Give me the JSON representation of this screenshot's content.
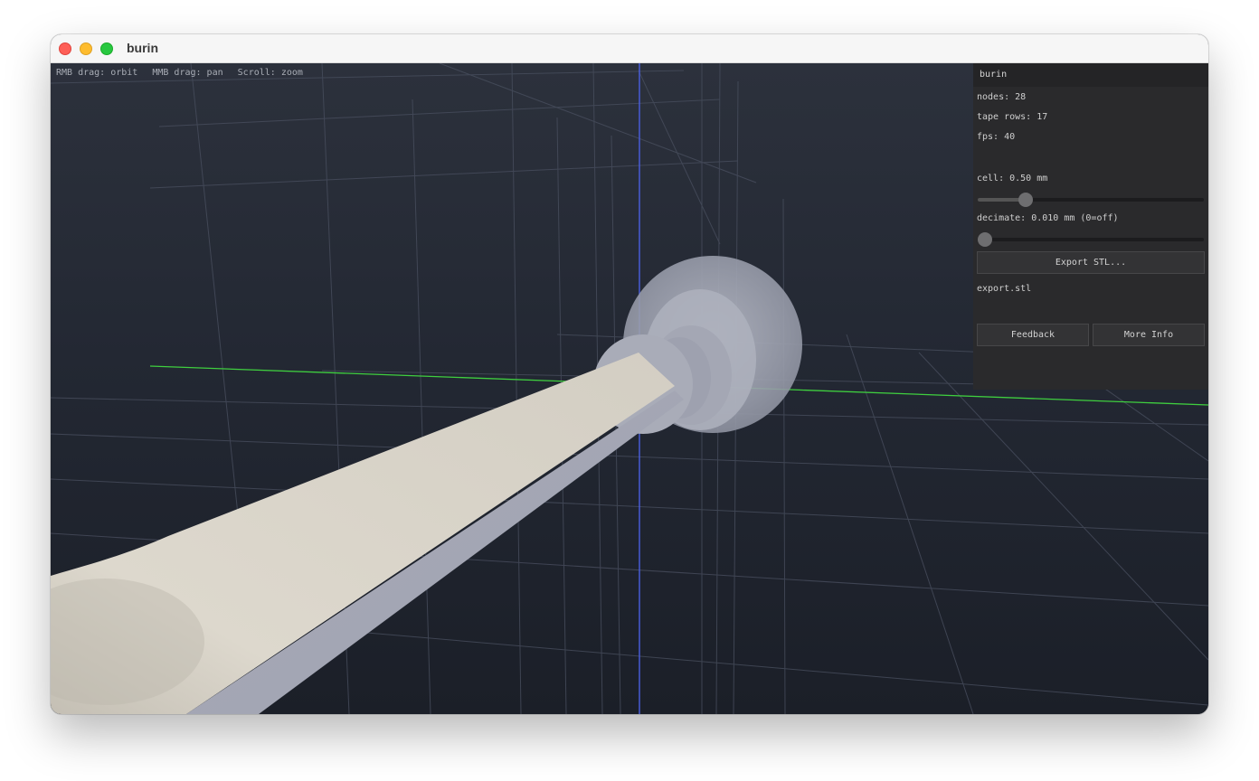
{
  "window": {
    "title": "burin"
  },
  "viewport": {
    "hints": [
      "RMB drag: orbit",
      "MMB drag: pan",
      "Scroll: zoom"
    ]
  },
  "panel": {
    "title": "burin",
    "nodes": "nodes: 28",
    "tape_rows": "tape rows: 17",
    "fps": "fps: 40",
    "cell_label": "cell: 0.50 mm",
    "cell_slider_fraction": 0.21,
    "decimate_label": "decimate: 0.010 mm (0=off)",
    "decimate_slider_fraction": 0.0,
    "export_button": "Export STL...",
    "export_filename": "export.stl",
    "feedback_button": "Feedback",
    "more_info_button": "More Info"
  },
  "colors": {
    "x_axis": "#3fcf3f",
    "z_axis": "#4a5fe0",
    "panel_bg": "#2a2a2c",
    "blade": "#d9d4c9"
  }
}
